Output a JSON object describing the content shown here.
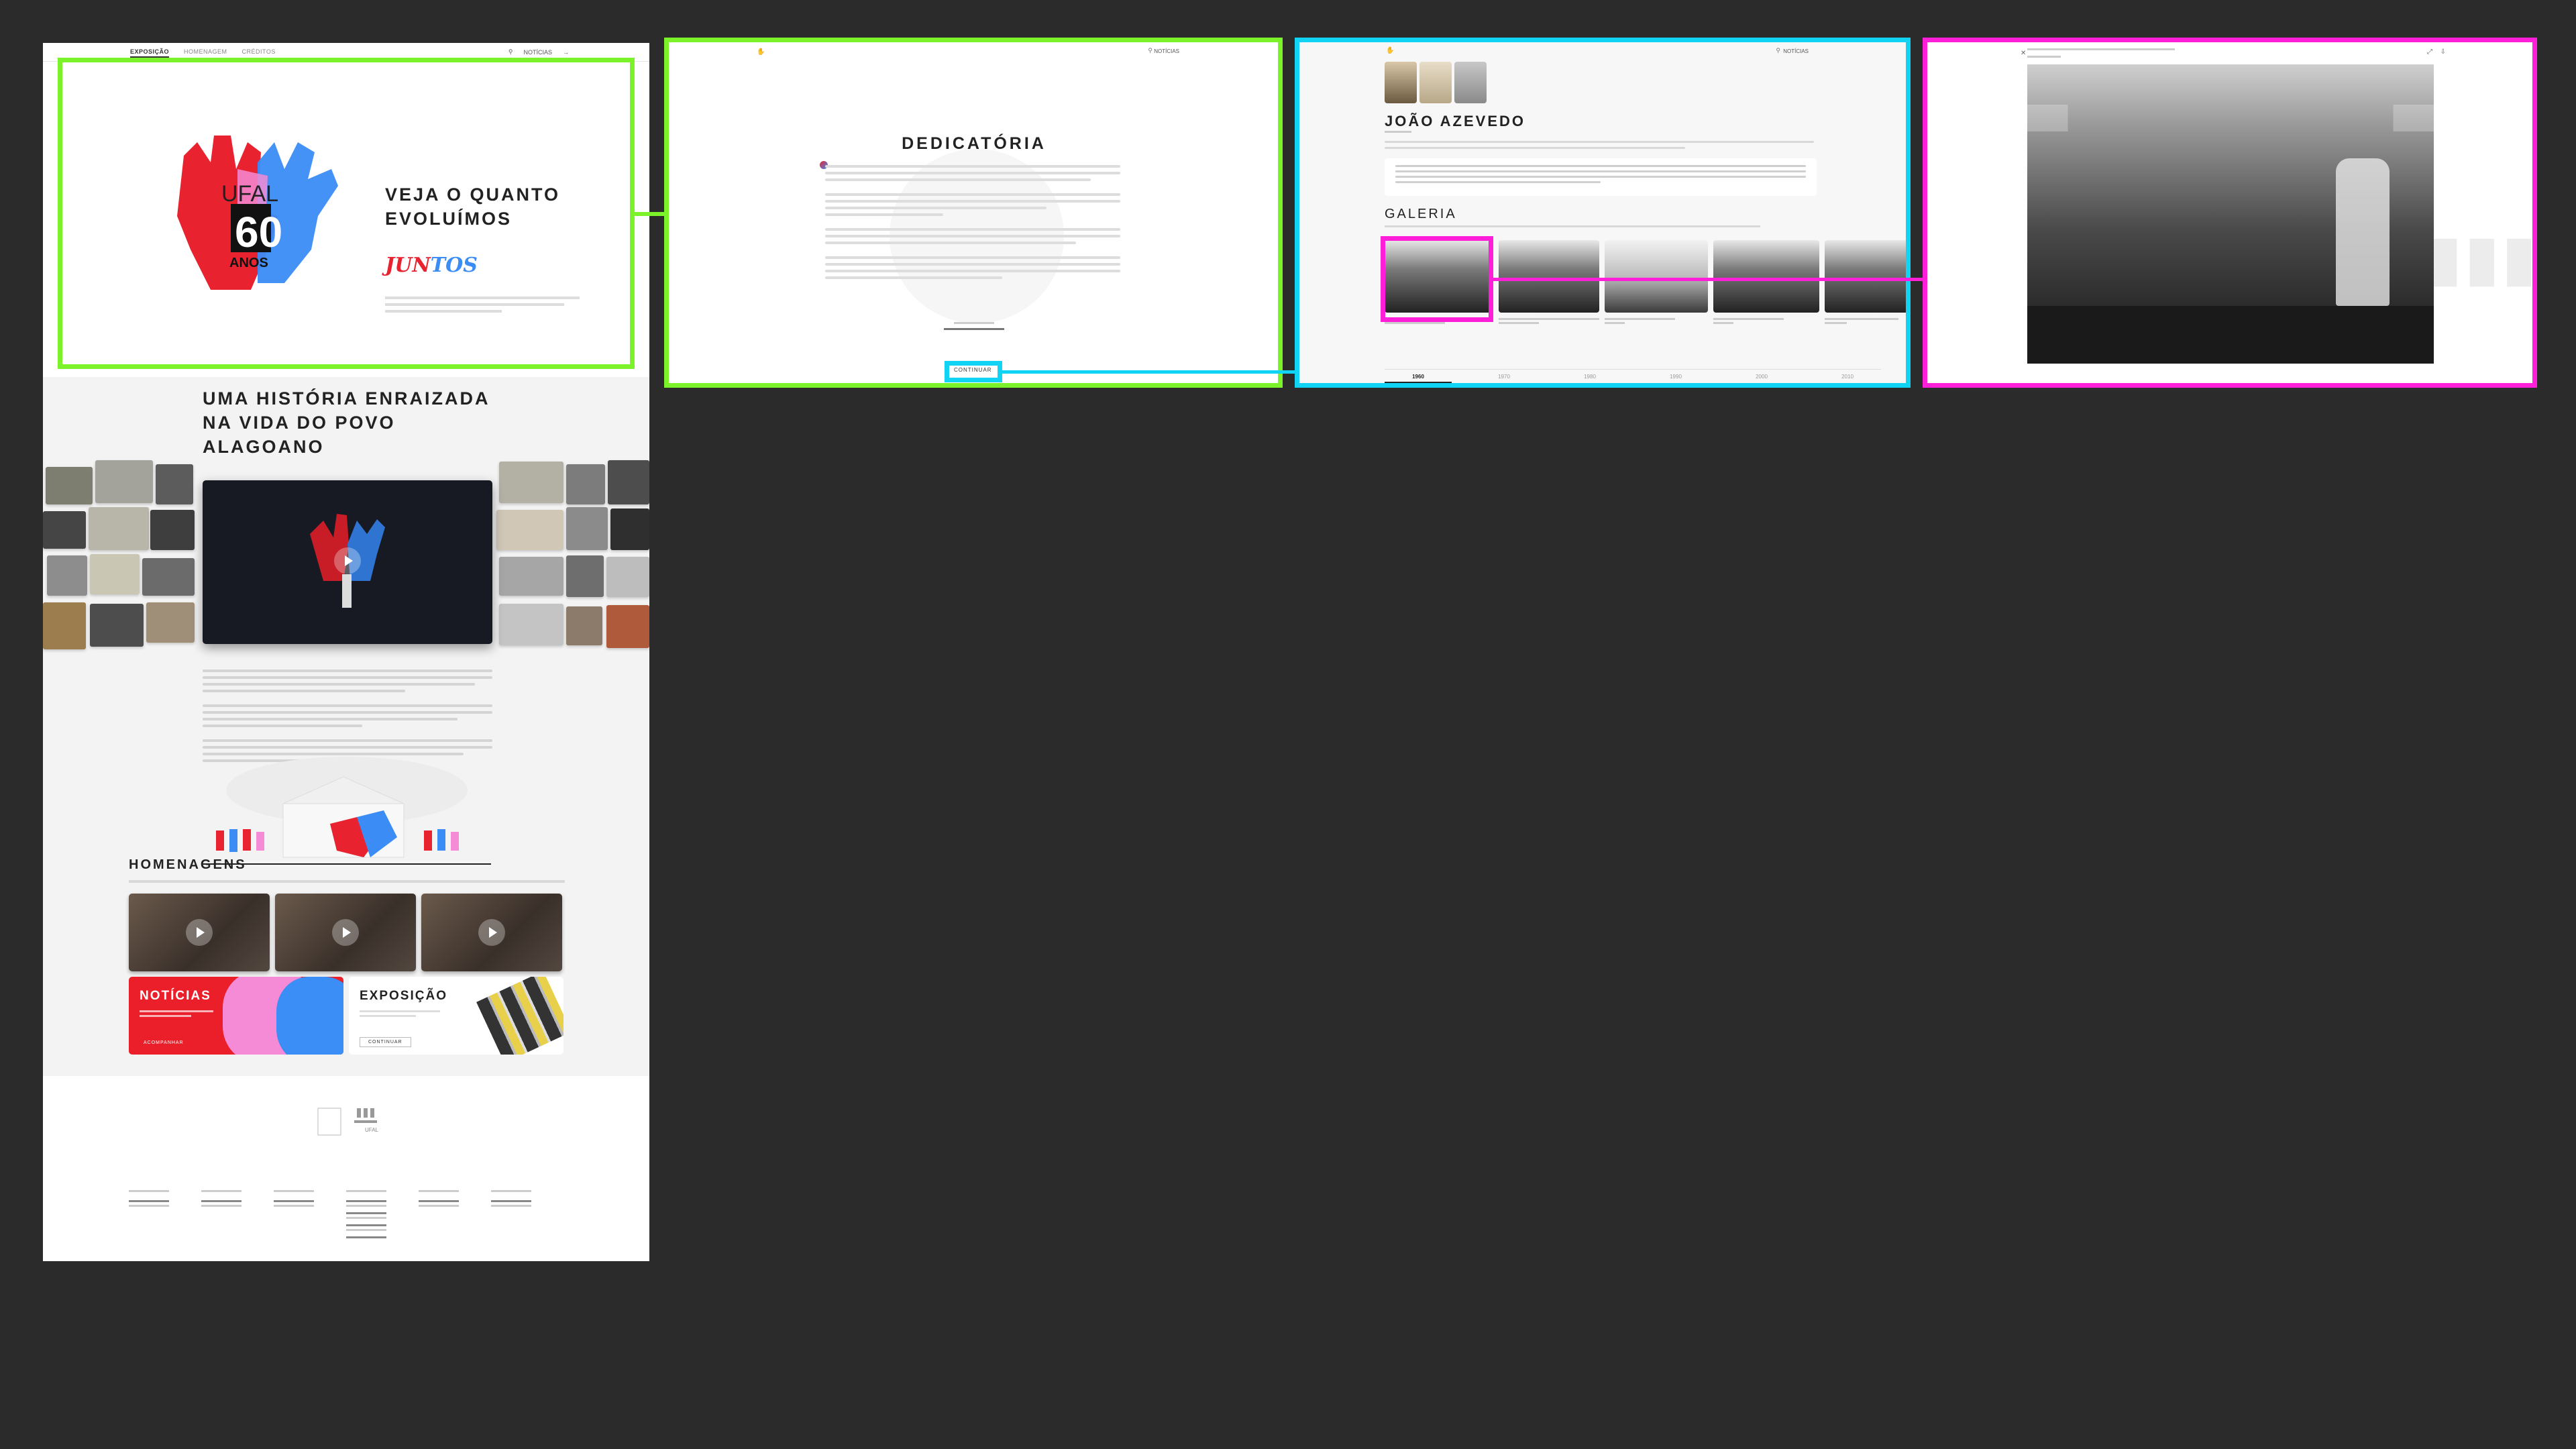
{
  "nav": {
    "items": [
      "EXPOSIÇÃO",
      "HOMENAGEM",
      "CRÉDITOS"
    ],
    "news_label": "NOTÍCIAS"
  },
  "hero": {
    "logo_text": "UFAL",
    "logo_number": "60",
    "logo_sub": "ANOS",
    "title": "VEJA O QUANTO EVOLUÍMOS",
    "script_word": "JUNTOS",
    "script_word_r": "JUN",
    "script_word_b": "TOS"
  },
  "history": {
    "title": "UMA HISTÓRIA ENRAIZADA NA VIDA DO POVO ALAGOANO"
  },
  "homenagens": {
    "title": "HOMENAGENS"
  },
  "cards": {
    "news_title": "NOTÍCIAS",
    "news_cta": "ACOMPANHAR",
    "expo_title": "EXPOSIÇÃO",
    "expo_cta": "CONTINUAR"
  },
  "footer": {
    "logo_label": "UFAL"
  },
  "dedicatoria": {
    "title": "DEDICATÓRIA",
    "continue_label": "CONTINUAR"
  },
  "person": {
    "name": "JOÃO AZEVEDO",
    "gallery_title": "GALERIA",
    "timeline": [
      "1960",
      "1970",
      "1980",
      "1990",
      "2000",
      "2010"
    ]
  },
  "colors": {
    "green": "#7cf22b",
    "cyan": "#11d4f4",
    "magenta": "#ff1fd9",
    "red": "#ea1f2a",
    "blue": "#3b8cf5",
    "pink": "#f58bd6"
  }
}
